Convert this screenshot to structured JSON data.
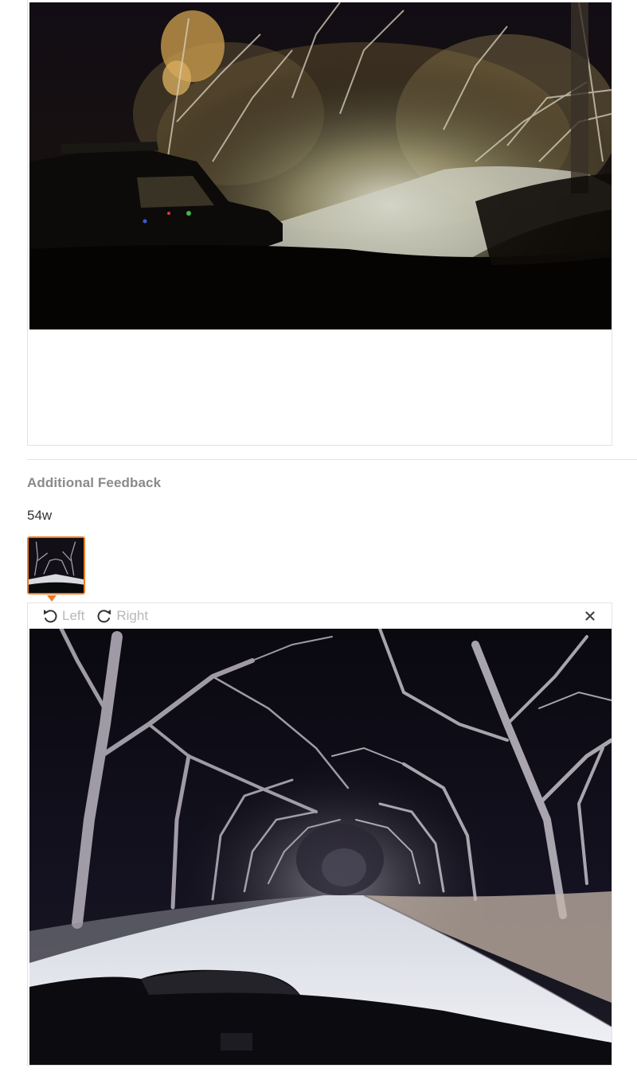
{
  "review": {
    "top_photo_icon": "night-trail-photo",
    "additional_feedback_label": "Additional Feedback",
    "additional_feedback_value": "54w"
  },
  "thumbnail": {
    "icon": "night-road-photo-thumbnail",
    "selected": true,
    "accent_color": "#f07b23"
  },
  "viewer": {
    "rotate_left_icon": "rotate-left-icon",
    "rotate_left_label": "Left",
    "rotate_right_icon": "rotate-right-icon",
    "rotate_right_label": "Right",
    "close_icon": "close-icon",
    "photo_icon": "night-road-photo"
  },
  "colors": {
    "label_gray": "#8a8a8a",
    "disabled_text": "#b8b8b8",
    "border": "#e2e2e2",
    "accent": "#f07b23"
  }
}
